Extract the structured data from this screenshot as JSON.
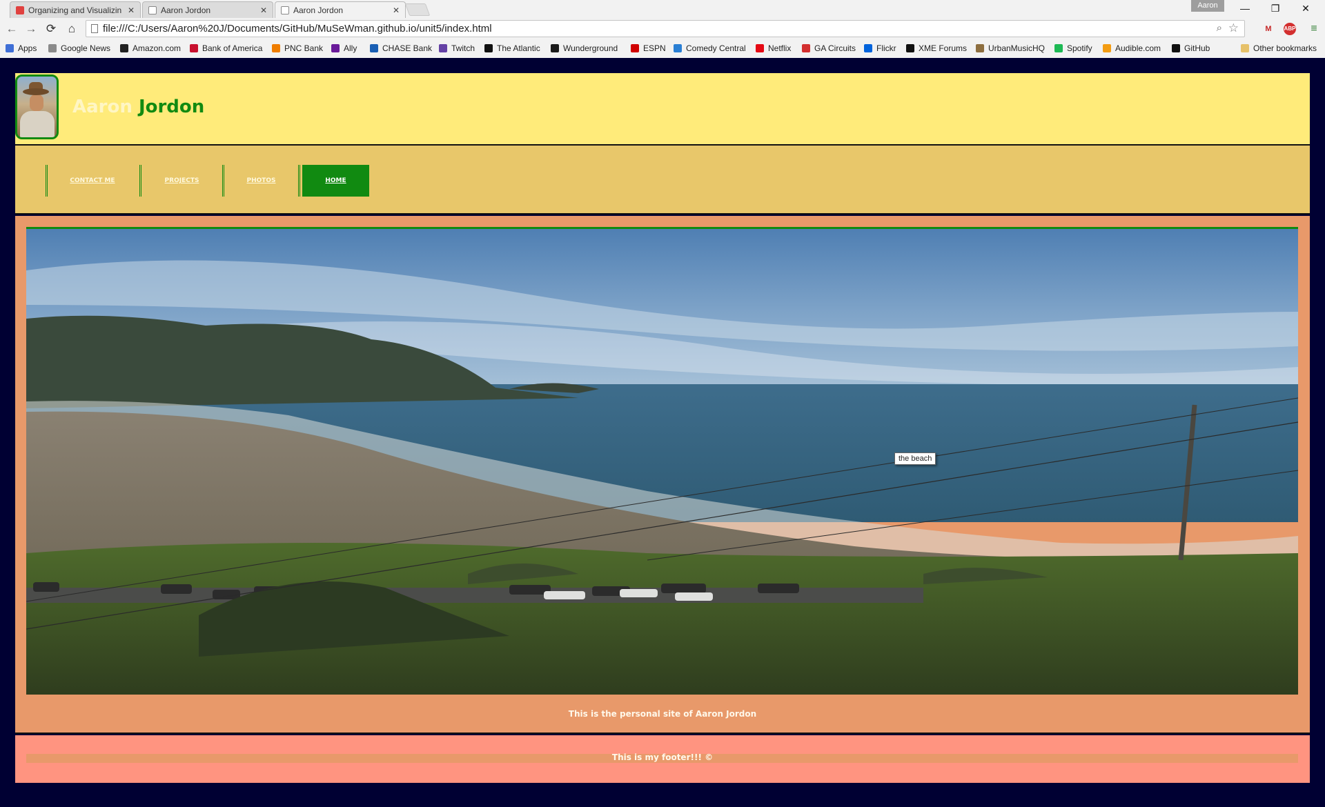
{
  "browser": {
    "tabs": [
      {
        "title": "Organizing and Visualizin",
        "icon": "coursera-icon",
        "active": false
      },
      {
        "title": "Aaron Jordon",
        "icon": "page-icon",
        "active": false
      },
      {
        "title": "Aaron Jordon",
        "icon": "page-icon",
        "active": true
      }
    ],
    "profile_name": "Aaron",
    "url": "file:///C:/Users/Aaron%20J/Documents/GitHub/MuSeWman.github.io/unit5/index.html",
    "bookmarks": [
      {
        "label": "Apps",
        "color": "#3f6fd6"
      },
      {
        "label": "Google News",
        "color": "#8a8a8a"
      },
      {
        "label": "Amazon.com",
        "color": "#222222"
      },
      {
        "label": "Bank of America",
        "color": "#c8102e"
      },
      {
        "label": "PNC Bank",
        "color": "#ef7d00"
      },
      {
        "label": "Ally",
        "color": "#6a1b9a"
      },
      {
        "label": "CHASE Bank",
        "color": "#1a5fb4"
      },
      {
        "label": "Twitch",
        "color": "#6441a5"
      },
      {
        "label": "The Atlantic",
        "color": "#111111"
      },
      {
        "label": "Wunderground",
        "color": "#1b1b1b"
      },
      {
        "label": "ESPN",
        "color": "#d00000"
      },
      {
        "label": "Comedy Central",
        "color": "#2a7fd4"
      },
      {
        "label": "Netflix",
        "color": "#e50914"
      },
      {
        "label": "GA Circuits",
        "color": "#d32f2f"
      },
      {
        "label": "Flickr",
        "color": "#0063dc"
      },
      {
        "label": "XME Forums",
        "color": "#111111"
      },
      {
        "label": "UrbanMusicHQ",
        "color": "#8d6e3f"
      },
      {
        "label": "Spotify",
        "color": "#1db954"
      },
      {
        "label": "Audible.com",
        "color": "#f39c12"
      },
      {
        "label": "GitHub",
        "color": "#111111"
      },
      {
        "label": "Other bookmarks",
        "color": "#e6c16a"
      }
    ]
  },
  "site": {
    "first_name": "Aaron",
    "last_name": "Jordon",
    "nav": [
      {
        "label": "CONTACT ME",
        "active": false
      },
      {
        "label": "PROJECTS",
        "active": false
      },
      {
        "label": "PHOTOS",
        "active": false
      },
      {
        "label": "HOME",
        "active": true
      }
    ],
    "hero_tooltip": "the beach",
    "tagline": "This is the personal site of Aaron Jordon",
    "footer": "This is my footer!!! ©"
  },
  "colors": {
    "page_bg": "#000033",
    "header_bg": "#ffeb7a",
    "nav_bg": "#e8c76a",
    "accent_green": "#118a11",
    "content_bg": "#e8996a",
    "footer_bg": "#ff9480"
  }
}
